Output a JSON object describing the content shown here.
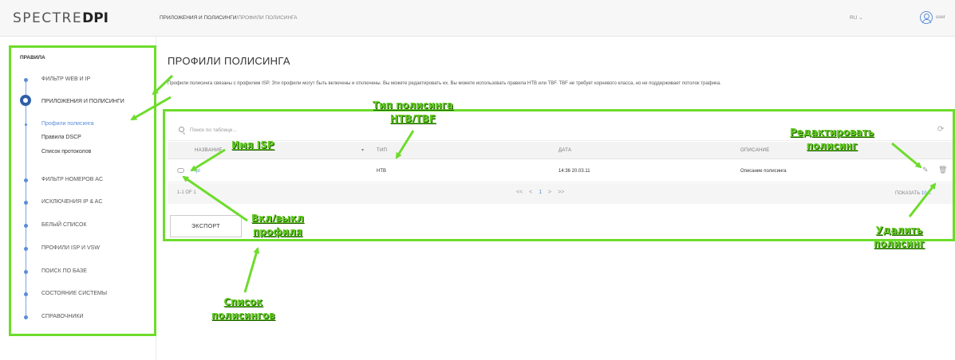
{
  "topbar": {
    "logo_light": "SPECTRE",
    "logo_bold": "DPI",
    "breadcrumb_1": "ПРИЛОЖЕНИЯ И ПОЛИСИНГИ",
    "breadcrumb_sep": "/",
    "breadcrumb_2": "ПРОФИЛИ ПОЛИСИНГА",
    "lang": "RU ⌄",
    "user": "user"
  },
  "sidebar": {
    "title": "ПРАВИЛА",
    "items": [
      {
        "label": "ФИЛЬТР WEB И IP"
      },
      {
        "label": "ПРИЛОЖЕНИЯ И ПОЛИСИНГИ"
      },
      {
        "label": "ФИЛЬТР НОМЕРОВ AC"
      },
      {
        "label": "ИСКЛЮЧЕНИЯ IP & AC"
      },
      {
        "label": "БЕЛЫЙ СПИСОК"
      },
      {
        "label": "ПРОФИЛИ ISP И VSW"
      },
      {
        "label": "ПОИСК ПО БАЗЕ"
      },
      {
        "label": "СОСТОЯНИЕ СИСТЕМЫ"
      },
      {
        "label": "СПРАВОЧНИКИ"
      }
    ],
    "subitems": [
      {
        "label": "Профили полисинга"
      },
      {
        "label": "Правила DSCP"
      },
      {
        "label": "Список протоколов"
      }
    ]
  },
  "main": {
    "title": "ПРОФИЛИ ПОЛИСИНГА",
    "description": "Профили полисинга связаны с профилем ISP. Эти профили могут быть включены и отключены. Вы можете редактировать их. Вы можете использовать правила HTB или TBF. TBF не требует корневого класса, но не поддерживает потолок трафика.",
    "search_placeholder": "Поиск по таблице...",
    "columns": [
      "НАЗВАНИЕ",
      "ТИП",
      "ДАТА",
      "ОПИСАНИЕ"
    ],
    "sort_icon": "▾",
    "rows": [
      {
        "name": "rpl",
        "type": "HTB",
        "date": "14:36 20.03.11",
        "description": "Описание полисинга"
      }
    ],
    "count": "1-1 OF 1",
    "pager": {
      "first": "<<",
      "prev": "<",
      "current": "1",
      "next": ">",
      "last": ">>"
    },
    "show_label": "ПОКАЗАТЬ",
    "show_value": "10 ⌄",
    "export_label": "ЭКСПОРТ"
  },
  "annotations": {
    "policing_type": "Тип полисинга\nHTB/TBF",
    "isp_name": "Имя ISP",
    "edit_policing": "Редактировать\nполисинг",
    "toggle_profile": "Вкл/выкл\nпрофиля",
    "delete_policing": "Удалить\nполисинг",
    "policing_list": "Список\nполисингов"
  },
  "colors": {
    "accent": "#5b8dd8",
    "annotation": "#6ddc2b",
    "annotation_text": "#63cc22"
  },
  "icons": [
    "user-icon",
    "search-icon",
    "refresh-icon",
    "edit-icon",
    "trash-icon",
    "toggle-icon"
  ]
}
